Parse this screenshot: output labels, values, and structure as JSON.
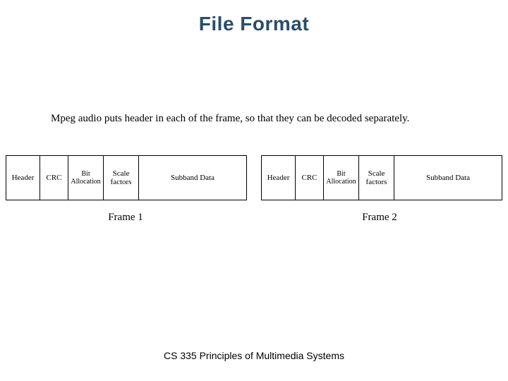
{
  "title": "File Format",
  "description": "Mpeg audio puts header in each of the frame, so that they can be decoded separately.",
  "frames": [
    {
      "label": "Frame 1",
      "cells": {
        "header": "Header",
        "crc": "CRC",
        "bit_allocation": "Bit Allocation",
        "scale_factors": "Scale factors",
        "subband_data": "Subband Data"
      }
    },
    {
      "label": "Frame 2",
      "cells": {
        "header": "Header",
        "crc": "CRC",
        "bit_allocation": "Bit Allocation",
        "scale_factors": "Scale factors",
        "subband_data": "Subband Data"
      }
    }
  ],
  "footer": "CS 335 Principles of Multimedia Systems"
}
